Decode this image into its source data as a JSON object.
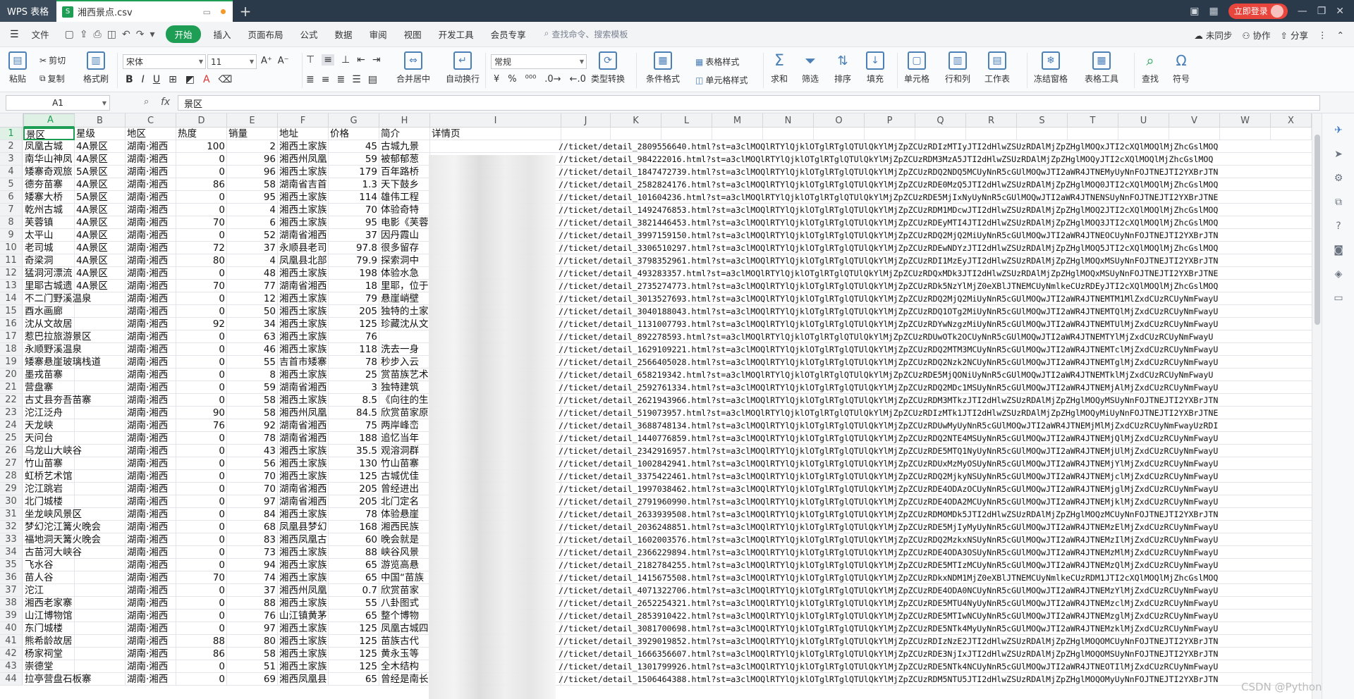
{
  "titlebar": {
    "app_tab": "WPS 表格",
    "file_tab": "湘西景点.csv",
    "file_icon": "S",
    "login": "立即登录"
  },
  "menubar": {
    "file": "文件",
    "tabs": [
      "开始",
      "插入",
      "页面布局",
      "公式",
      "数据",
      "审阅",
      "视图",
      "开发工具",
      "会员专享"
    ],
    "search": "查找命令、搜索模板",
    "right": [
      "未同步",
      "协作",
      "分享"
    ]
  },
  "ribbon": {
    "paste": "粘贴",
    "cut": "剪切",
    "copy": "复制",
    "format_painter": "格式刷",
    "font_name": "宋体",
    "font_size": "11",
    "merge_center": "合并居中",
    "wrap_text": "自动换行",
    "number_format": "常规",
    "type_convert": "类型转换",
    "conditional_format": "条件格式",
    "table_style": "表格样式",
    "cell_style": "单元格样式",
    "sum": "求和",
    "filter": "筛选",
    "sort": "排序",
    "fill": "填充",
    "cell": "单元格",
    "row_col": "行和列",
    "worksheet": "工作表",
    "freeze": "冻结窗格",
    "table_tools": "表格工具",
    "find": "查找",
    "symbol": "符号"
  },
  "formula_bar": {
    "name_box": "A1",
    "fx": "fx",
    "content": "景区"
  },
  "columns": [
    "A",
    "B",
    "C",
    "D",
    "E",
    "F",
    "G",
    "H",
    "I",
    "J",
    "K",
    "L",
    "M",
    "N",
    "O",
    "P",
    "Q",
    "R",
    "S",
    "T",
    "U",
    "V",
    "W",
    "X"
  ],
  "rows": [
    {
      "n": "1",
      "a": "景区",
      "b": "星级",
      "c": "地区",
      "d": "热度",
      "e": "销量",
      "f": "地址",
      "g": "价格",
      "h": "简介",
      "i": "详情页"
    },
    {
      "n": "2",
      "a": "凤凰古城",
      "b": "4A景区",
      "c": "湖南·湘西",
      "d": "100",
      "e": "2",
      "f": "湘西土家族",
      "g": "45",
      "h": "古城九景",
      "url": "//ticket/detail_2809556640.html?st=a3clMOQlRTYlQjklOTglRTglQTUlQkYlMjZpZCUzRDIzMTIyJTI2dHlwZSUzRDAlMjZpZHglMOQxJTI2cXQlMOQlMjZhcGslMOQ"
    },
    {
      "n": "3",
      "a": "南华山神凤",
      "b": "4A景区",
      "c": "湖南·湘西",
      "d": "0",
      "e": "96",
      "f": "湘西州凤凰",
      "g": "59",
      "h": "被郁郁葱",
      "url": "//ticket/detail_984222016.html?st=a3clMOQlRTYlQjklOTglRTglQTUlQkYlMjZpZCUzRDM3MzA5JTI2dHlwZSUzRDAlMjZpZHglMOQyJTI2cXQlMOQlMjZhcGslMOQ"
    },
    {
      "n": "4",
      "a": "矮寨奇观旅",
      "b": "5A景区",
      "c": "湖南·湘西",
      "d": "0",
      "e": "96",
      "f": "湘西土家族",
      "g": "179",
      "h": "百年路桥",
      "url": "//ticket/detail_1847472739.html?st=a3clMOQlRTYlQjklOTglRTglQTUlQkYlMjZpZCUzRDQ2NDQ5MCUyNnR5cGUlMOQwJTI2aWR4JTNEMyUyNnFOJTNEJTI2YXBrJTN"
    },
    {
      "n": "5",
      "a": "德夯苗寨",
      "b": "4A景区",
      "c": "湖南·湘西",
      "d": "86",
      "e": "58",
      "f": "湖南省吉首",
      "g": "1.3",
      "h": "天下鼓乡",
      "url": "//ticket/detail_2582824176.html?st=a3clMOQlRTYlQjklOTglRTglQTUlQkYlMjZpZCUzRDE0MzQ5JTI2dHlwZSUzRDAlMjZpZHglMOQ0JTI2cXQlMOQlMjZhcGslMOQ"
    },
    {
      "n": "6",
      "a": "矮寨大桥",
      "b": "5A景区",
      "c": "湖南·湘西",
      "d": "0",
      "e": "95",
      "f": "湘西土家族",
      "g": "114",
      "h": "雄伟工程",
      "url": "//ticket/detail_101604236.html?st=a3clMOQlRTYlQjklOTglRTglQTUlQkYlMjZpZCUzRDE5MjIxNyUyNnR5cGUlMOQwJTI2aWR4JTNENSUyNnFOJTNEJTI2YXBrJTNE"
    },
    {
      "n": "7",
      "a": "乾州古城",
      "b": "4A景区",
      "c": "湖南·湘西",
      "d": "0",
      "e": "4",
      "f": "湘西土家族",
      "g": "70",
      "h": "体验奇特",
      "url": "//ticket/detail_1492476853.html?st=a3clMOQlRTYlQjklOTglRTglQTUlQkYlMjZpZCUzRDM1MDcwJTI2dHlwZSUzRDAlMjZpZHglMOQ2JTI2cXQlMOQlMjZhcGslMOQ"
    },
    {
      "n": "8",
      "a": "芙蓉镇",
      "b": "4A景区",
      "c": "湖南·湘西",
      "d": "70",
      "e": "6",
      "f": "湘西土家族",
      "g": "95",
      "h": "电影《芙蓉",
      "url": "//ticket/detail_3821446453.html?st=a3clMOQlRTYlQjklOTglRTglQTUlQkYlMjZpZCUzRDEyMTI4JTI2dHlwZSUzRDAlMjZpZHglMOQ3JTI2cXQlMOQlMjZhcGslMOQ"
    },
    {
      "n": "9",
      "a": "太平山",
      "b": "4A景区",
      "c": "湖南·湘西",
      "d": "0",
      "e": "52",
      "f": "湖南省湘西",
      "g": "37",
      "h": "因丹霞山",
      "url": "//ticket/detail_3997159150.html?st=a3clMOQlRTYlQjklOTglRTglQTUlQkYlMjZpZCUzRDQ2MjQ2MiUyNnR5cGUlMOQwJTI2aWR4JTNEOCUyNnFOJTNEJTI2YXBrJTN"
    },
    {
      "n": "10",
      "a": "老司城",
      "b": "4A景区",
      "c": "湖南·湘西",
      "d": "72",
      "e": "37",
      "f": "永顺县老司",
      "g": "97.8",
      "h": "很多留存",
      "url": "//ticket/detail_3306510297.html?st=a3clMOQlRTYlQjklOTglRTglQTUlQkYlMjZpZCUzRDEwNDYzJTI2dHlwZSUzRDAlMjZpZHglMOQ5JTI2cXQlMOQlMjZhcGslMOQ"
    },
    {
      "n": "11",
      "a": "奇梁洞",
      "b": "4A景区",
      "c": "湖南·湘西",
      "d": "80",
      "e": "4",
      "f": "凤凰县北部",
      "g": "79.9",
      "h": "探索洞中",
      "url": "//ticket/detail_3798352961.html?st=a3clMOQlRTYlQjklOTglRTglQTUlQkYlMjZpZCUzRDI1MzEyJTI2dHlwZSUzRDAlMjZpZHglMOQxMSUyNnFOJTNEJTI2YXBrJTN"
    },
    {
      "n": "12",
      "a": "猛洞河漂流",
      "b": "4A景区",
      "c": "湖南·湘西",
      "d": "0",
      "e": "48",
      "f": "湘西土家族",
      "g": "198",
      "h": "体验水急",
      "url": "//ticket/detail_493283357.html?st=a3clMOQlRTYlQjklOTglRTglQTUlQkYlMjZpZCUzRDQxMDk3JTI2dHlwZSUzRDAlMjZpZHglMOQxMSUyNnFOJTNEJTI2YXBrJTNE"
    },
    {
      "n": "13",
      "a": "里耶古城遗",
      "b": "4A景区",
      "c": "湖南·湘西",
      "d": "70",
      "e": "77",
      "f": "湖南省湘西",
      "g": "18",
      "h": "里耶，位于",
      "url": "//ticket/detail_2735274773.html?st=a3clMOQlRTYlQjklOTglRTglQTUlQkYlMjZpZCUzRDk5NzYlMjZ0eXBlJTNEMCUyNmlkeCUzRDEyJTI2cXQlMOQlMjZhcGslMOQ"
    },
    {
      "n": "14",
      "a": "不二门野溪温泉",
      "b": "",
      "c": "湖南·湘西",
      "d": "0",
      "e": "12",
      "f": "湘西土家族",
      "g": "79",
      "h": "悬崖峭壁",
      "url": "//ticket/detail_3013527693.html?st=a3clMOQlRTYlQjklOTglRTglQTUlQkYlMjZpZCUzRDQ2MjQ2MiUyNnR5cGUlMOQwJTI2aWR4JTNEMTM1MlZxdCUzRCUyNmFwayU"
    },
    {
      "n": "15",
      "a": "酉水画廊",
      "b": "",
      "c": "湖南·湘西",
      "d": "0",
      "e": "50",
      "f": "湘西土家族",
      "g": "205",
      "h": "独特的土家",
      "url": "//ticket/detail_3040188043.html?st=a3clMOQlRTYlQjklOTglRTglQTUlQkYlMjZpZCUzRDQ1OTg2MiUyNnR5cGUlMOQwJTI2aWR4JTNEMTQlMjZxdCUzRCUyNmFwayU"
    },
    {
      "n": "16",
      "a": "沈从文故居",
      "b": "",
      "c": "湖南·湘西",
      "d": "92",
      "e": "34",
      "f": "湘西土家族",
      "g": "125",
      "h": "珍藏沈从文",
      "url": "//ticket/detail_1131007793.html?st=a3clMOQlRTYlQjklOTglRTglQTUlQkYlMjZpZCUzRDYwNzgzMiUyNnR5cGUlMOQwJTI2aWR4JTNEMTUlMjZxdCUzRCUyNmFwayU"
    },
    {
      "n": "17",
      "a": "惹巴拉旅游景区",
      "b": "",
      "c": "湖南·湘西",
      "d": "0",
      "e": "63",
      "f": "湘西土家族",
      "g": "76",
      "h": "",
      "url": "//ticket/detail_892278593.html?st=a3clMOQlRTYlQjklOTglRTglQTUlQkYlMjZpZCUzRDUwOTk2OCUyNnR5cGUlMOQwJTI2aWR4JTNEMTYlMjZxdCUzRCUyNmFwayU"
    },
    {
      "n": "18",
      "a": "永顺野溪温泉",
      "b": "",
      "c": "湖南·湘西",
      "d": "0",
      "e": "46",
      "f": "湘西土家族",
      "g": "118",
      "h": "洗去一身",
      "url": "//ticket/detail_1629109221.html?st=a3clMOQlRTYlQjklOTglRTglQTUlQkYlMjZpZCUzRDQ2MTM3MCUyNnR5cGUlMOQwJTI2aWR4JTNEMTclMjZxdCUzRCUyNmFwayU"
    },
    {
      "n": "19",
      "a": "矮寨悬崖玻璃栈道",
      "b": "",
      "c": "湖南·湘西",
      "d": "0",
      "e": "55",
      "f": "吉首市矮寨",
      "g": "78",
      "h": "秒步入云",
      "url": "//ticket/detail_2566405028.html?st=a3clMOQlRTYlQjklOTglRTglQTUlQkYlMjZpZCUzRDQ2Nzk2NCUyNnR5cGUlMOQwJTI2aWR4JTNEMTglMjZxdCUzRCUyNmFwayU"
    },
    {
      "n": "20",
      "a": "墨戎苗寨",
      "b": "",
      "c": "湖南·湘西",
      "d": "0",
      "e": "8",
      "f": "湘西土家族",
      "g": "25",
      "h": "赏苗族艺术",
      "url": "//ticket/detail_658219342.html?st=a3clMOQlRTYlQjklOTglRTglQTUlQkYlMjZpZCUzRDE5MjQONiUyNnR5cGUlMOQwJTI2aWR4JTNEMTklMjZxdCUzRCUyNmFwayU"
    },
    {
      "n": "21",
      "a": "营盘寨",
      "b": "",
      "c": "湖南·湘西",
      "d": "0",
      "e": "59",
      "f": "湖南省湘西",
      "g": "3",
      "h": "独特建筑",
      "url": "//ticket/detail_2592761334.html?st=a3clMOQlRTYlQjklOTglRTglQTUlQkYlMjZpZCUzRDQ2MDc1MSUyNnR5cGUlMOQwJTI2aWR4JTNEMjAlMjZxdCUzRCUyNmFwayU"
    },
    {
      "n": "22",
      "a": "古丈县夯吾苗寨",
      "b": "",
      "c": "湖南·湘西",
      "d": "0",
      "e": "58",
      "f": "湘西土家族",
      "g": "8.5",
      "h": "《向往的生",
      "url": "//ticket/detail_2621943966.html?st=a3clMOQlRTYlQjklOTglRTglQTUlQkYlMjZpZCUzRDM3MTkzJTI2dHlwZSUzRDAlMjZpZHglMOQyMSUyNnFOJTNEJTI2YXBrJTN"
    },
    {
      "n": "23",
      "a": "沱江泛舟",
      "b": "",
      "c": "湖南·湘西",
      "d": "90",
      "e": "58",
      "f": "湘西州凤凰",
      "g": "84.5",
      "h": "欣赏苗家原",
      "url": "//ticket/detail_519073957.html?st=a3clMOQlRTYlQjklOTglRTglQTUlQkYlMjZpZCUzRDIzMTk1JTI2dHlwZSUzRDAlMjZpZHglMOQyMiUyNnFOJTNEJTI2YXBrJTNE"
    },
    {
      "n": "24",
      "a": "天龙峡",
      "b": "",
      "c": "湖南·湘西",
      "d": "76",
      "e": "92",
      "f": "湖南省湘西",
      "g": "75",
      "h": "两岸峰峦",
      "url": "//ticket/detail_3688748134.html?st=a3clMOQlRTYlQjklOTglRTglQTUlQkYlMjZpZCUzRDUwMyUyNnR5cGUlMOQwJTI2aWR4JTNEMjMlMjZxdCUzRCUyNmFwayUzRDI"
    },
    {
      "n": "25",
      "a": "天问台",
      "b": "",
      "c": "湖南·湘西",
      "d": "0",
      "e": "78",
      "f": "湖南省湘西",
      "g": "188",
      "h": "追忆当年",
      "url": "//ticket/detail_1440776859.html?st=a3clMOQlRTYlQjklOTglRTglQTUlQkYlMjZpZCUzRDQ2NTE4MSUyNnR5cGUlMOQwJTI2aWR4JTNEMjQlMjZxdCUzRCUyNmFwayU"
    },
    {
      "n": "26",
      "a": "乌龙山大峡谷",
      "b": "",
      "c": "湖南·湘西",
      "d": "0",
      "e": "43",
      "f": "湘西土家族",
      "g": "35.5",
      "h": "观溶洞群",
      "url": "//ticket/detail_2342916957.html?st=a3clMOQlRTYlQjklOTglRTglQTUlQkYlMjZpZCUzRDE5MTQ1NyUyNnR5cGUlMOQwJTI2aWR4JTNEMjUlMjZxdCUzRCUyNmFwayU"
    },
    {
      "n": "27",
      "a": "竹山苗寨",
      "b": "",
      "c": "湖南·湘西",
      "d": "0",
      "e": "56",
      "f": "湘西土家族",
      "g": "130",
      "h": "竹山苗寨",
      "url": "//ticket/detail_1002842941.html?st=a3clMOQlRTYlQjklOTglRTglQTUlQkYlMjZpZCUzRDUxMzMyOSUyNnR5cGUlMOQwJTI2aWR4JTNEMjYlMjZxdCUzRCUyNmFwayU"
    },
    {
      "n": "28",
      "a": "虹桥艺术馆",
      "b": "",
      "c": "湖南·湘西",
      "d": "0",
      "e": "70",
      "f": "湘西土家族",
      "g": "125",
      "h": "古城优佳",
      "url": "//ticket/detail_3375422461.html?st=a3clMOQlRTYlQjklOTglRTglQTUlQkYlMjZpZCUzRDQ2MjkyNSUyNnR5cGUlMOQwJTI2aWR4JTNEMjclMjZxdCUzRCUyNmFwayU"
    },
    {
      "n": "29",
      "a": "沱江跳岩",
      "b": "",
      "c": "湖南·湘西",
      "d": "0",
      "e": "70",
      "f": "湖南省湘西",
      "g": "205",
      "h": "曾经进出",
      "url": "//ticket/detail_1997038462.html?st=a3clMOQlRTYlQjklOTglRTglQTUlQkYlMjZpZCUzRDE4ODAzOCUyNnR5cGUlMOQwJTI2aWR4JTNEMjglMjZxdCUzRCUyNmFwayU"
    },
    {
      "n": "30",
      "a": "北门城楼",
      "b": "",
      "c": "湖南·湘西",
      "d": "0",
      "e": "97",
      "f": "湖南省湘西",
      "g": "205",
      "h": "北门定名",
      "url": "//ticket/detail_2791960990.html?st=a3clMOQlRTYlQjklOTglRTglQTUlQkYlMjZpZCUzRDE4ODA2MCUyNnR5cGUlMOQwJTI2aWR4JTNEMjklMjZxdCUzRCUyNmFwayU"
    },
    {
      "n": "31",
      "a": "坐龙峡风景区",
      "b": "",
      "c": "湖南·湘西",
      "d": "0",
      "e": "84",
      "f": "湘西土家族",
      "g": "78",
      "h": "体验悬崖",
      "url": "//ticket/detail_2633939508.html?st=a3clMOQlRTYlQjklOTglRTglQTUlQkYlMjZpZCUzRDMOMDk5JTI2dHlwZSUzRDAlMjZpZHglMOQzMCUyNnFOJTNEJTI2YXBrJTN"
    },
    {
      "n": "32",
      "a": "梦幻沱江篝火晚会",
      "b": "",
      "c": "湖南·湘西",
      "d": "0",
      "e": "68",
      "f": "凤凰县梦幻",
      "g": "168",
      "h": "湘西民族",
      "url": "//ticket/detail_2036248851.html?st=a3clMOQlRTYlQjklOTglRTglQTUlQkYlMjZpZCUzRDE5MjIyMyUyNnR5cGUlMOQwJTI2aWR4JTNEMzElMjZxdCUzRCUyNmFwayU"
    },
    {
      "n": "33",
      "a": "福地洞天篝火晚会",
      "b": "",
      "c": "湖南·湘西",
      "d": "0",
      "e": "83",
      "f": "湘西凤凰古",
      "g": "60",
      "h": "晚会就是",
      "url": "//ticket/detail_1602003576.html?st=a3clMOQlRTYlQjklOTglRTglQTUlQkYlMjZpZCUzRDQ2MzkxNSUyNnR5cGUlMOQwJTI2aWR4JTNEMzIlMjZxdCUzRCUyNmFwayU"
    },
    {
      "n": "34",
      "a": "古苗河大峡谷",
      "b": "",
      "c": "湖南·湘西",
      "d": "0",
      "e": "73",
      "f": "湘西土家族",
      "g": "88",
      "h": "峡谷风景",
      "url": "//ticket/detail_2366229894.html?st=a3clMOQlRTYlQjklOTglRTglQTUlQkYlMjZpZCUzRDE4ODA3OSUyNnR5cGUlMOQwJTI2aWR4JTNEMzMlMjZxdCUzRCUyNmFwayU"
    },
    {
      "n": "35",
      "a": "飞水谷",
      "b": "",
      "c": "湖南·湘西",
      "d": "0",
      "e": "94",
      "f": "湘西土家族",
      "g": "65",
      "h": "游览高悬",
      "url": "//ticket/detail_2182784255.html?st=a3clMOQlRTYlQjklOTglRTglQTUlQkYlMjZpZCUzRDE5MTIzMCUyNnR5cGUlMOQwJTI2aWR4JTNEMzQlMjZxdCUzRCUyNmFwayU"
    },
    {
      "n": "36",
      "a": "苗人谷",
      "b": "",
      "c": "湖南·湘西",
      "d": "70",
      "e": "74",
      "f": "湘西土家族",
      "g": "65",
      "h": "中国“苗族",
      "url": "//ticket/detail_1415675508.html?st=a3clMOQlRTYlQjklOTglRTglQTUlQkYlMjZpZCUzRDkxNDM1MjZ0eXBlJTNEMCUyNmlkeCUzRDM1JTI2cXQlMOQlMjZhcGslMOQ"
    },
    {
      "n": "37",
      "a": "沱江",
      "b": "",
      "c": "湖南·湘西",
      "d": "0",
      "e": "37",
      "f": "湘西州凤凰",
      "g": "0.7",
      "h": "欣赏苗家",
      "url": "//ticket/detail_4071322706.html?st=a3clMOQlRTYlQjklOTglRTglQTUlQkYlMjZpZCUzRDE4ODA0NCUyNnR5cGUlMOQwJTI2aWR4JTNEMzYlMjZxdCUzRCUyNmFwayU"
    },
    {
      "n": "38",
      "a": "湘西老家寨",
      "b": "",
      "c": "湖南·湘西",
      "d": "0",
      "e": "88",
      "f": "湘西土家族",
      "g": "55",
      "h": "八卦图式",
      "url": "//ticket/detail_2652254321.html?st=a3clMOQlRTYlQjklOTglRTglQTUlQkYlMjZpZCUzRDE5MTU4NyUyNnR5cGUlMOQwJTI2aWR4JTNEMzclMjZxdCUzRCUyNmFwayU"
    },
    {
      "n": "39",
      "a": "山江博物馆",
      "b": "",
      "c": "湖南·湘西",
      "d": "0",
      "e": "76",
      "f": "山江镇黄茅",
      "g": "65",
      "h": "整个博物",
      "url": "//ticket/detail_2853910422.html?st=a3clMOQlRTYlQjklOTglRTglQTUlQkYlMjZpZCUzRDE5MTIwNCUyNnR5cGUlMOQwJTI2aWR4JTNEMzglMjZxdCUzRCUyNmFwayU"
    },
    {
      "n": "40",
      "a": "东门城楼",
      "b": "",
      "c": "湖南·湘西",
      "d": "0",
      "e": "97",
      "f": "湘西土家族",
      "g": "125",
      "h": "凤凰古城四",
      "url": "//ticket/detail_3081700698.html?st=a3clMOQlRTYlQjklOTglRTglQTUlQkYlMjZpZCUzRDE5NTk4MyUyNnR5cGUlMOQwJTI2aWR4JTNEMzklMjZxdCUzRCUyNmFwayU"
    },
    {
      "n": "41",
      "a": "熊希龄故居",
      "b": "",
      "c": "湖南·湘西",
      "d": "88",
      "e": "80",
      "f": "湘西土家族",
      "g": "125",
      "h": "苗族古代",
      "url": "//ticket/detail_3929019852.html?st=a3clMOQlRTYlQjklOTglRTglQTUlQkYlMjZpZCUzRDIzNzE2JTI2dHlwZSUzRDAlMjZpZHglMOQOMCUyNnFOJTNEJTI2YXBrJTN"
    },
    {
      "n": "42",
      "a": "杨家祠堂",
      "b": "",
      "c": "湖南·湘西",
      "d": "86",
      "e": "58",
      "f": "湘西土家族",
      "g": "125",
      "h": "黄永玉等",
      "url": "//ticket/detail_1666356607.html?st=a3clMOQlRTYlQjklOTglRTglQTUlQkYlMjZpZCUzRDE3NjIxJTI2dHlwZSUzRDAlMjZpZHglMOQOMSUyNnFOJTNEJTI2YXBrJTN"
    },
    {
      "n": "43",
      "a": "崇德堂",
      "b": "",
      "c": "湖南·湘西",
      "d": "0",
      "e": "51",
      "f": "湘西土家族",
      "g": "125",
      "h": "全木结构",
      "url": "//ticket/detail_1301799926.html?st=a3clMOQlRTYlQjklOTglRTglQTUlQkYlMjZpZCUzRDE5NTk4NCUyNnR5cGUlMOQwJTI2aWR4JTNEOTIlMjZxdCUzRCUyNmFwayU"
    },
    {
      "n": "44",
      "a": "拉亭营盘石板寨",
      "b": "",
      "c": "湖南·湘西",
      "d": "0",
      "e": "69",
      "f": "湘西凤凰县",
      "g": "65",
      "h": "曾经是南长",
      "url": "//ticket/detail_1506464388.html?st=a3clMOQlRTYlQjklOTglRTglQTUlQkYlMjZpZCUzRDM5NTU5JTI2dHlwZSUzRDAlMjZpZHglMOQOMyUyNnFOJTNEJTI2YXBrJTN"
    }
  ],
  "watermark": "CSDN @Python"
}
